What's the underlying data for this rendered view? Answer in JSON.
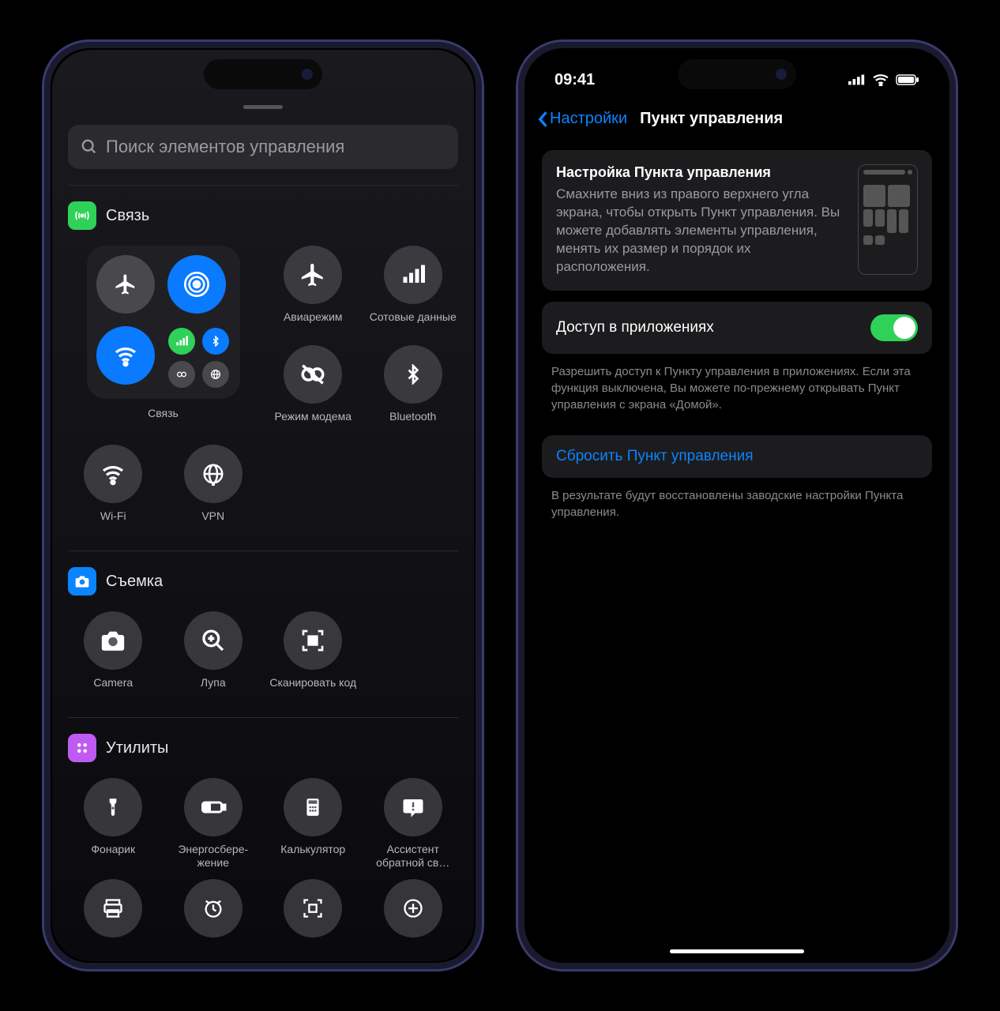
{
  "left": {
    "search_placeholder": "Поиск элементов управления",
    "sections": {
      "conn": {
        "title": "Связь",
        "cluster_label": "Связь",
        "airplane": "Авиарежим",
        "cellular": "Сотовые данные",
        "hotspot": "Режим модема",
        "bluetooth": "Bluetooth",
        "wifi": "Wi-Fi",
        "vpn": "VPN"
      },
      "capture": {
        "title": "Съемка",
        "camera": "Camera",
        "magnifier": "Лупа",
        "scan": "Сканировать код"
      },
      "utils": {
        "title": "Утилиты",
        "flashlight": "Фонарик",
        "lowpower": "Энергосбере­жение",
        "calculator": "Калькулятор",
        "assistant": "Ассистент обратной св…"
      }
    }
  },
  "right": {
    "time": "09:41",
    "back": "Настройки",
    "title": "Пункт управления",
    "card": {
      "title": "Настройка Пункта управления",
      "body": "Смахните вниз из правого верхнего угла экрана, чтобы открыть Пункт управления. Вы можете добавлять элементы управления, менять их размер и порядок их расположения."
    },
    "access": {
      "label": "Доступ в приложениях",
      "footer": "Разрешить доступ к Пункту управления в приложе­ниях. Если эта функция выключена, Вы можете по-прежнему открывать Пункт управления с экрана «Домой».",
      "enabled": true
    },
    "reset": {
      "label": "Сбросить Пункт управления",
      "footer": "В результате будут восстановлены заводские настройки Пункта управления."
    }
  }
}
